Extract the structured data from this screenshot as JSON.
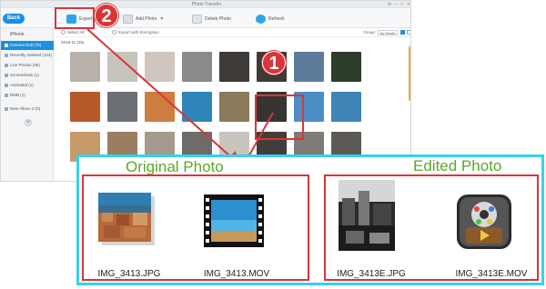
{
  "window": {
    "title": "Photo Transfer",
    "controls": [
      "⚙",
      "—",
      "□",
      "✕"
    ]
  },
  "toolbar": {
    "back_label": "Back",
    "export_label": "Export",
    "add_photo_label": "Add Photo",
    "delete_photo_label": "Delete Photo",
    "refresh_label": "Refresh",
    "dropdown_caret": "▼"
  },
  "sidebar": {
    "device": "iPhone",
    "items": [
      {
        "label": "Camera Roll (75)",
        "active": true
      },
      {
        "label": "Recently Deleted (104)",
        "active": false
      },
      {
        "label": "Live Photos (38)",
        "active": false
      },
      {
        "label": "Screenshots (1)",
        "active": false
      },
      {
        "label": "Animated (1)",
        "active": false
      },
      {
        "label": "RMB (1)",
        "active": false
      },
      {
        "label": "New Album 2 (0)",
        "active": false
      }
    ],
    "add_label": "+"
  },
  "content": {
    "select_all": "Select All",
    "export_encryption": "Export with Encryption",
    "group_label": "Group:",
    "group_value": "by Month",
    "date_group": "2018-11 (25)",
    "thumbnail_colors": [
      [
        "#b8b1aa",
        "#c7c3bd",
        "#cfc7bf",
        "#8a8a8a",
        "#3d3a37",
        "#403a36",
        "#5d7c9a",
        "#2e3c2c"
      ],
      [
        "#b65a2a",
        "#6c6f74",
        "#cc7d3f",
        "#2d85b8",
        "#8b7a5a",
        "#363433",
        "#4d8ec5",
        "#3e84b6"
      ],
      [
        "#c89a6a",
        "#9b7e62",
        "#a59a8d",
        "#6e6b68",
        "#c9c4bd",
        "#403d3a",
        "#7f7a75",
        "#5d5a56"
      ]
    ]
  },
  "comparison": {
    "original_heading": "Original Photo",
    "edited_heading": "Edited Photo",
    "original_files": [
      "IMG_3413.JPG",
      "IMG_3413.MOV"
    ],
    "edited_files": [
      "IMG_3413E.JPG",
      "IMG_3413E.MOV"
    ]
  },
  "annotations": {
    "step1": "1",
    "step2": "2",
    "color": "#d8353a",
    "panel_border": "#35d3e8",
    "heading_color": "#5aa829"
  }
}
